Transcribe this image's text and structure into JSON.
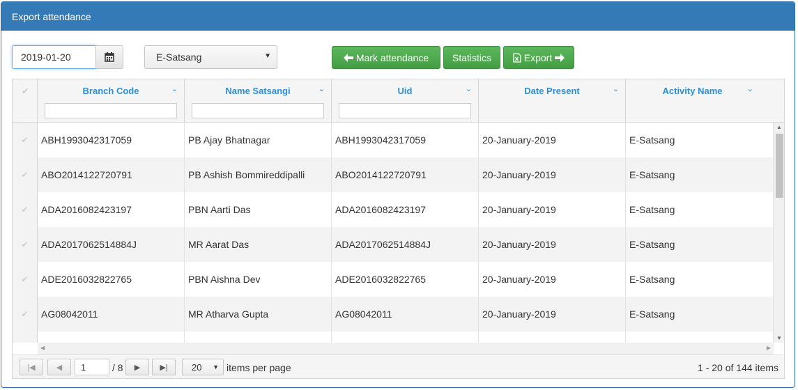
{
  "panel": {
    "title": "Export attendance"
  },
  "toolbar": {
    "date_value": "2019-01-20",
    "activity_selected": "E-Satsang",
    "mark_label": "Mark attendance",
    "stats_label": "Statistics",
    "export_label": "Export"
  },
  "grid": {
    "columns": [
      {
        "title": "Branch Code"
      },
      {
        "title": "Name Satsangi"
      },
      {
        "title": "Uid"
      },
      {
        "title": "Date Present"
      },
      {
        "title": "Activity Name"
      }
    ],
    "rows": [
      {
        "branch": "ABH1993042317059",
        "name": "PB Ajay Bhatnagar",
        "uid": "ABH1993042317059",
        "date": "20-January-2019",
        "activity": "E-Satsang"
      },
      {
        "branch": "ABO2014122720791",
        "name": "PB Ashish Bommireddipalli",
        "uid": "ABO2014122720791",
        "date": "20-January-2019",
        "activity": "E-Satsang"
      },
      {
        "branch": "ADA2016082423197",
        "name": "PBN Aarti Das",
        "uid": "ADA2016082423197",
        "date": "20-January-2019",
        "activity": "E-Satsang"
      },
      {
        "branch": "ADA2017062514884J",
        "name": "MR Aarat Das",
        "uid": "ADA2017062514884J",
        "date": "20-January-2019",
        "activity": "E-Satsang"
      },
      {
        "branch": "ADE2016032822765",
        "name": "PBN Aishna Dev",
        "uid": "ADE2016032822765",
        "date": "20-January-2019",
        "activity": "E-Satsang"
      },
      {
        "branch": "AG08042011",
        "name": "MR Atharva Gupta",
        "uid": "AG08042011",
        "date": "20-January-2019",
        "activity": "E-Satsang"
      }
    ]
  },
  "pager": {
    "current_page": "1",
    "of_pages": "/ 8",
    "items_per_page": "20",
    "items_per_page_label": "items per page",
    "summary": "1 - 20 of 144 items"
  },
  "icons": {
    "calendar": "calendar-icon",
    "arrow_left": "arrow-left-icon",
    "arrow_right": "arrow-right-icon",
    "excel": "excel-file-icon",
    "column_menu": "chevron-down-icon",
    "check": "check-icon"
  },
  "colors": {
    "header_bg": "#337ab7",
    "button_green": "#5cb85c",
    "column_title": "#2e8fd6"
  }
}
